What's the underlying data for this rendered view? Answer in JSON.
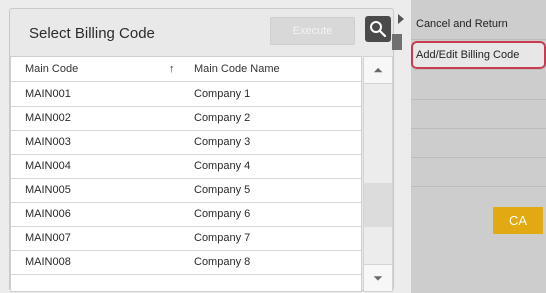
{
  "dialog": {
    "title": "Select Billing Code",
    "execute_label": "Execute",
    "table": {
      "columns": [
        "Main Code",
        "Main Code Name"
      ],
      "rows": [
        [
          "MAIN001",
          "Company 1"
        ],
        [
          "MAIN002",
          "Company 2"
        ],
        [
          "MAIN003",
          "Company 3"
        ],
        [
          "MAIN004",
          "Company 4"
        ],
        [
          "MAIN005",
          "Company 5"
        ],
        [
          "MAIN006",
          "Company 6"
        ],
        [
          "MAIN007",
          "Company 7"
        ],
        [
          "MAIN008",
          "Company 8"
        ]
      ]
    }
  },
  "right_menu": {
    "items": [
      "Cancel and Return",
      "Add/Edit Billing Code"
    ],
    "ca_label": "CA"
  },
  "colors": {
    "highlight_border": "#c83b52",
    "ca_button": "#e0aa10"
  },
  "icons": [
    "search-icon",
    "sort-up-icon",
    "chevron-up-icon",
    "chevron-down-icon",
    "side-arrow-icon"
  ]
}
